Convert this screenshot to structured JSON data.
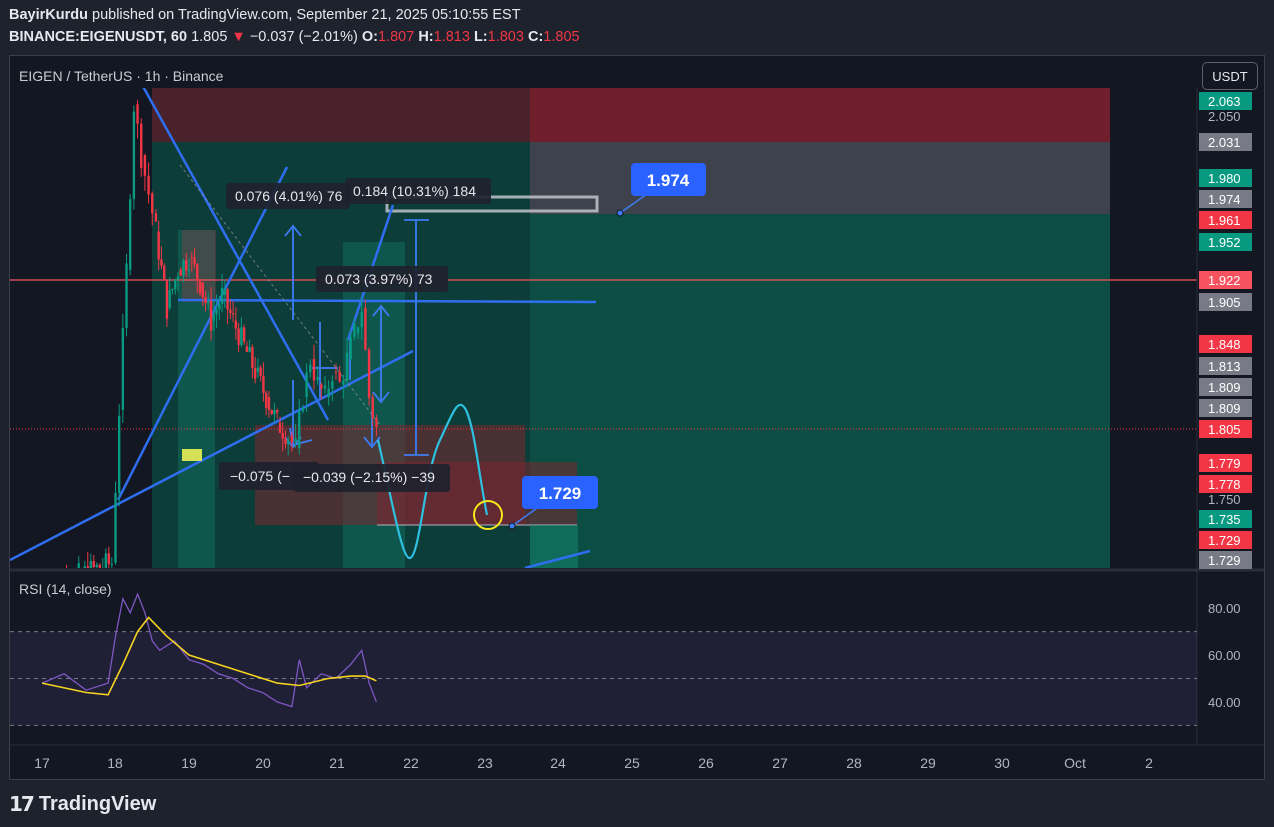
{
  "header": {
    "author": "BayirKurdu",
    "published_text": "published on TradingView.com, September 21, 2025 05:10:55 EST",
    "symbol": "BINANCE:EIGENUSDT, 60",
    "last": "1.805",
    "change_arrow": "▼",
    "change": "−0.037 (−2.01%)",
    "o_label": "O:",
    "o": "1.807",
    "h_label": "H:",
    "h": "1.813",
    "l_label": "L:",
    "l": "1.803",
    "c_label": "C:",
    "c": "1.805"
  },
  "legend": {
    "symbol_label": "EIGEN / TetherUS · 1h · Binance",
    "currency": "USDT"
  },
  "rsi_label": "RSI (14, close)",
  "logo_text": "TradingView",
  "colors": {
    "up": "#089981",
    "down": "#f23645",
    "accent": "#2962ff",
    "rsi": "#7e57c2",
    "rsi_ma": "#f5d320"
  },
  "chart_data": [
    {
      "type": "candlestick",
      "pair": "EIGEN / TetherUS",
      "interval": "1h",
      "exchange": "Binance",
      "x_tick_labels": [
        "17",
        "18",
        "19",
        "20",
        "21",
        "22",
        "23",
        "24",
        "25",
        "26",
        "27",
        "28",
        "29",
        "30",
        "Oct",
        "2"
      ],
      "price_axis_labels": [
        {
          "text": "2.063",
          "color": "#089981"
        },
        {
          "text": "2.050",
          "color": null
        },
        {
          "text": "2.031",
          "color": "#787b86"
        },
        {
          "text": "1.980",
          "color": "#089981"
        },
        {
          "text": "1.974",
          "color": "#787b86"
        },
        {
          "text": "1.961",
          "color": "#f23645"
        },
        {
          "text": "1.952",
          "color": "#089981"
        },
        {
          "text": "1.922",
          "color": "#f7525f"
        },
        {
          "text": "1.905",
          "color": "#787b86"
        },
        {
          "text": "1.848",
          "color": "#f23645"
        },
        {
          "text": "1.813",
          "color": "#787b86"
        },
        {
          "text": "1.809",
          "color": "#787b86"
        },
        {
          "text": "1.809",
          "color": "#787b86"
        },
        {
          "text": "1.805",
          "color": "#f23645"
        },
        {
          "text": "1.779",
          "color": "#f23645"
        },
        {
          "text": "1.778",
          "color": "#f23645"
        },
        {
          "text": "1.750",
          "color": null
        },
        {
          "text": "1.735",
          "color": "#089981"
        },
        {
          "text": "1.729",
          "color": "#f23645"
        },
        {
          "text": "1.729",
          "color": "#787b86"
        }
      ],
      "last_price": 1.805,
      "horizontal_line": 1.922,
      "target_labels": [
        "1.974",
        "1.729"
      ],
      "measurements": [
        "0.076 (4.01%) 76",
        "0.184 (10.31%) 184",
        "0.073 (3.97%) 73",
        "−0.075 (−",
        "−0.039 (−2.15%) −39"
      ],
      "price_series": [
        {
          "day": 17.0,
          "price": 1.68
        },
        {
          "day": 17.5,
          "price": 1.69
        },
        {
          "day": 17.95,
          "price": 1.7
        },
        {
          "day": 18.05,
          "price": 1.82
        },
        {
          "day": 18.15,
          "price": 1.93
        },
        {
          "day": 18.25,
          "price": 2.06
        },
        {
          "day": 18.35,
          "price": 2.02
        },
        {
          "day": 18.45,
          "price": 1.99
        },
        {
          "day": 18.55,
          "price": 1.96
        },
        {
          "day": 18.7,
          "price": 1.9
        },
        {
          "day": 18.85,
          "price": 1.93
        },
        {
          "day": 19.0,
          "price": 1.94
        },
        {
          "day": 19.15,
          "price": 1.92
        },
        {
          "day": 19.3,
          "price": 1.89
        },
        {
          "day": 19.45,
          "price": 1.91
        },
        {
          "day": 19.6,
          "price": 1.89
        },
        {
          "day": 19.75,
          "price": 1.87
        },
        {
          "day": 19.9,
          "price": 1.85
        },
        {
          "day": 20.05,
          "price": 1.83
        },
        {
          "day": 20.2,
          "price": 1.81
        },
        {
          "day": 20.35,
          "price": 1.8
        },
        {
          "day": 20.45,
          "price": 1.79
        },
        {
          "day": 20.55,
          "price": 1.83
        },
        {
          "day": 20.65,
          "price": 1.86
        },
        {
          "day": 20.75,
          "price": 1.84
        },
        {
          "day": 20.85,
          "price": 1.83
        },
        {
          "day": 20.95,
          "price": 1.85
        },
        {
          "day": 21.05,
          "price": 1.84
        },
        {
          "day": 21.15,
          "price": 1.86
        },
        {
          "day": 21.25,
          "price": 1.88
        },
        {
          "day": 21.35,
          "price": 1.9
        },
        {
          "day": 21.45,
          "price": 1.83
        },
        {
          "day": 21.55,
          "price": 1.805
        }
      ]
    },
    {
      "type": "line",
      "name": "RSI (14, close)",
      "y_tick_labels": [
        "80.00",
        "60.00",
        "40.00"
      ],
      "ylim": [
        28,
        92
      ],
      "bands": [
        30,
        50,
        70
      ],
      "series": [
        {
          "role": "rsi",
          "color": "#7e57c2",
          "points": [
            {
              "day": 17.0,
              "value": 48
            },
            {
              "day": 17.3,
              "value": 52
            },
            {
              "day": 17.6,
              "value": 45
            },
            {
              "day": 17.9,
              "value": 48
            },
            {
              "day": 18.0,
              "value": 68
            },
            {
              "day": 18.1,
              "value": 84
            },
            {
              "day": 18.2,
              "value": 78
            },
            {
              "day": 18.3,
              "value": 86
            },
            {
              "day": 18.4,
              "value": 78
            },
            {
              "day": 18.5,
              "value": 66
            },
            {
              "day": 18.6,
              "value": 62
            },
            {
              "day": 18.8,
              "value": 66
            },
            {
              "day": 19.0,
              "value": 58
            },
            {
              "day": 19.2,
              "value": 56
            },
            {
              "day": 19.4,
              "value": 52
            },
            {
              "day": 19.6,
              "value": 50
            },
            {
              "day": 19.8,
              "value": 46
            },
            {
              "day": 20.0,
              "value": 44
            },
            {
              "day": 20.2,
              "value": 40
            },
            {
              "day": 20.4,
              "value": 38
            },
            {
              "day": 20.5,
              "value": 58
            },
            {
              "day": 20.6,
              "value": 46
            },
            {
              "day": 20.8,
              "value": 52
            },
            {
              "day": 21.0,
              "value": 50
            },
            {
              "day": 21.2,
              "value": 56
            },
            {
              "day": 21.35,
              "value": 62
            },
            {
              "day": 21.45,
              "value": 48
            },
            {
              "day": 21.55,
              "value": 40
            }
          ]
        },
        {
          "role": "rsi_ma",
          "color": "#f5d320",
          "points": [
            {
              "day": 17.0,
              "value": 48
            },
            {
              "day": 17.6,
              "value": 44
            },
            {
              "day": 17.9,
              "value": 43
            },
            {
              "day": 18.1,
              "value": 56
            },
            {
              "day": 18.3,
              "value": 70
            },
            {
              "day": 18.45,
              "value": 76
            },
            {
              "day": 18.7,
              "value": 68
            },
            {
              "day": 19.0,
              "value": 60
            },
            {
              "day": 19.4,
              "value": 56
            },
            {
              "day": 19.8,
              "value": 52
            },
            {
              "day": 20.2,
              "value": 48
            },
            {
              "day": 20.5,
              "value": 47
            },
            {
              "day": 20.9,
              "value": 50
            },
            {
              "day": 21.2,
              "value": 51
            },
            {
              "day": 21.4,
              "value": 51
            },
            {
              "day": 21.55,
              "value": 49
            }
          ]
        }
      ]
    }
  ]
}
